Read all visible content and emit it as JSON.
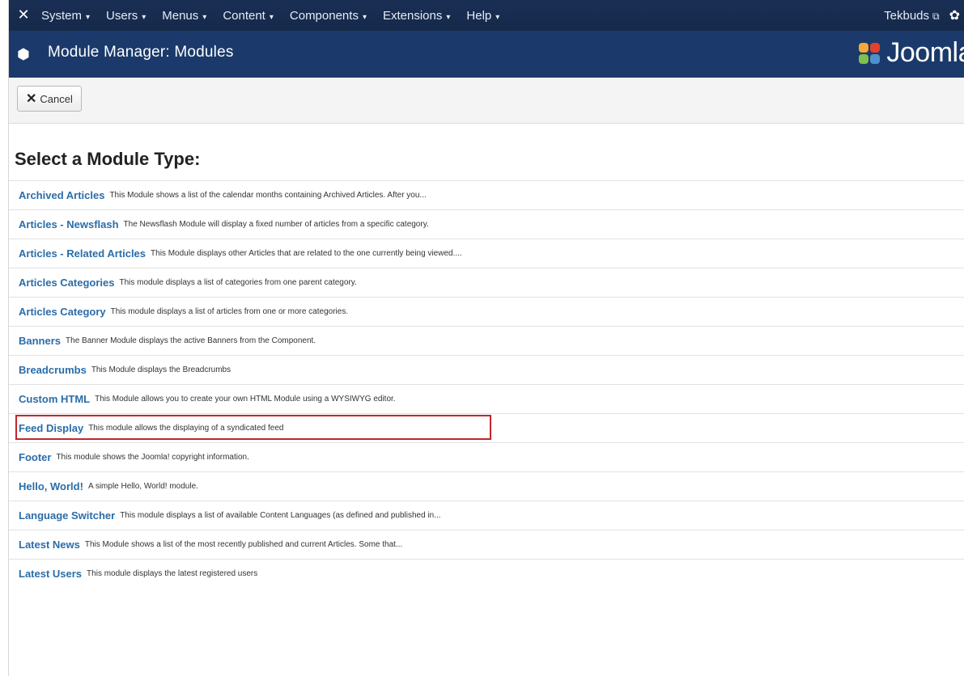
{
  "navbar": {
    "menu": [
      {
        "label": "System"
      },
      {
        "label": "Users"
      },
      {
        "label": "Menus"
      },
      {
        "label": "Content"
      },
      {
        "label": "Components"
      },
      {
        "label": "Extensions"
      },
      {
        "label": "Help"
      }
    ],
    "user": "Tekbuds"
  },
  "header": {
    "title": "Module Manager: Modules",
    "brand": "Joomla"
  },
  "toolbar": {
    "cancel_label": "Cancel"
  },
  "main": {
    "heading": "Select a Module Type:",
    "highlighted_index": 8,
    "modules": [
      {
        "name": "Archived Articles",
        "desc": "This Module shows a list of the calendar months containing Archived Articles. After you..."
      },
      {
        "name": "Articles - Newsflash",
        "desc": "The Newsflash Module will display a fixed number of articles from a specific category."
      },
      {
        "name": "Articles - Related Articles",
        "desc": "This Module displays other Articles that are related to the one currently being viewed...."
      },
      {
        "name": "Articles Categories",
        "desc": "This module displays a list of categories from one parent category."
      },
      {
        "name": "Articles Category",
        "desc": "This module displays a list of articles from one or more categories."
      },
      {
        "name": "Banners",
        "desc": "The Banner Module displays the active Banners from the Component."
      },
      {
        "name": "Breadcrumbs",
        "desc": "This Module displays the Breadcrumbs"
      },
      {
        "name": "Custom HTML",
        "desc": "This Module allows you to create your own HTML Module using a WYSIWYG editor."
      },
      {
        "name": "Feed Display",
        "desc": "This module allows the displaying of a syndicated feed"
      },
      {
        "name": "Footer",
        "desc": "This module shows the Joomla! copyright information."
      },
      {
        "name": "Hello, World!",
        "desc": "A simple Hello, World! module."
      },
      {
        "name": "Language Switcher",
        "desc": "This module displays a list of available Content Languages (as defined and published in..."
      },
      {
        "name": "Latest News",
        "desc": "This Module shows a list of the most recently published and current Articles. Some that..."
      },
      {
        "name": "Latest Users",
        "desc": "This module displays the latest registered users"
      }
    ]
  }
}
